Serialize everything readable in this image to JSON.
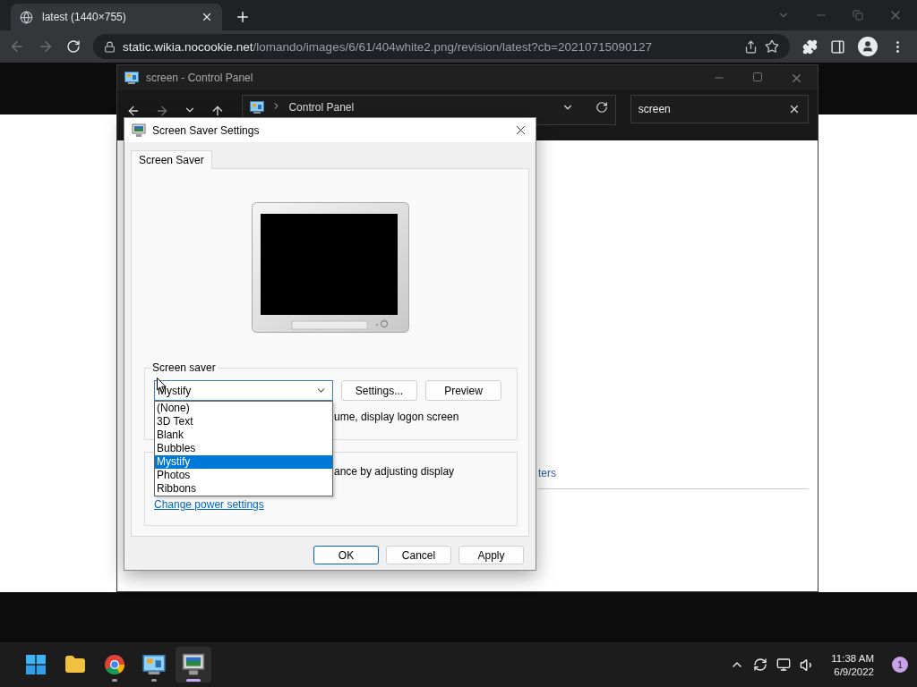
{
  "browser": {
    "tab": {
      "title": "latest (1440×755)"
    },
    "address": {
      "host": "static.wikia.nocookie.net",
      "path": "/lomando/images/6/61/404white2.png/revision/latest?cb=20210715090127"
    }
  },
  "explorer": {
    "title": "screen - Control Panel",
    "breadcrumb": "Control Panel",
    "search": {
      "value": "screen"
    },
    "link_fragment": "ters"
  },
  "dialog": {
    "title": "Screen Saver Settings",
    "tabs": [
      {
        "label": "Screen Saver",
        "selected": true
      }
    ],
    "screen_saver_group": {
      "label": "Screen saver",
      "combo": {
        "value": "Mystify",
        "expanded": true
      },
      "options": [
        {
          "label": "(None)",
          "selected": false
        },
        {
          "label": "3D Text",
          "selected": false
        },
        {
          "label": "Blank",
          "selected": false
        },
        {
          "label": "Bubbles",
          "selected": false
        },
        {
          "label": "Mystify",
          "selected": true
        },
        {
          "label": "Photos",
          "selected": false
        },
        {
          "label": "Ribbons",
          "selected": false
        }
      ],
      "buttons": [
        "Settings...",
        "Preview"
      ],
      "logon_text": "ume, display logon screen"
    },
    "power_group": {
      "text": "ance by adjusting display",
      "link": "Change power settings"
    },
    "buttons": [
      {
        "label": "OK",
        "default": true
      },
      {
        "label": "Cancel",
        "default": false
      },
      {
        "label": "Apply",
        "default": false
      }
    ]
  },
  "taskbar": {
    "apps": [
      {
        "kind": "files",
        "running": false,
        "selected": false
      },
      {
        "kind": "browser",
        "running": true,
        "selected": false
      },
      {
        "kind": "control-panel",
        "running": true,
        "selected": false
      },
      {
        "kind": "screensaver",
        "running": true,
        "selected": true
      }
    ],
    "clock": {
      "time": "11:38 AM",
      "date": "6/9/2022"
    },
    "notifications": "1"
  }
}
